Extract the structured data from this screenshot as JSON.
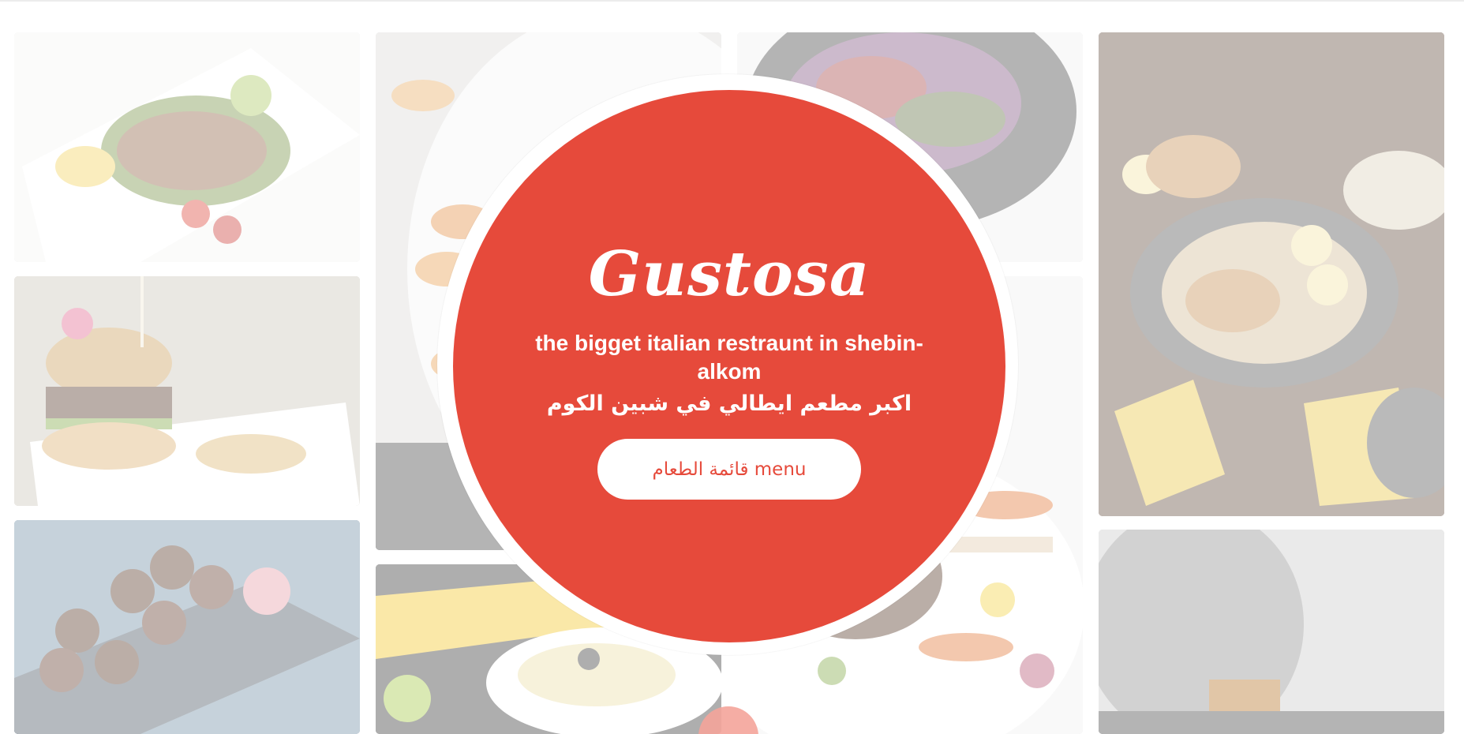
{
  "hero": {
    "title": "Gustosa",
    "tagline_en": "the bigget italian restraunt in shebin-alkom",
    "tagline_ar": "اكبر مطعم ايطالي في شبين الكوم",
    "menu_button_label": "قائمة الطعام menu"
  },
  "gallery": [
    {
      "name": "grilled-salmon-photo"
    },
    {
      "name": "burger-photo"
    },
    {
      "name": "sushi-photo"
    },
    {
      "name": "shrimp-photo"
    },
    {
      "name": "pasta-photo"
    },
    {
      "name": "salad-photo"
    },
    {
      "name": "ribs-photo"
    },
    {
      "name": "fried-platter-photo"
    },
    {
      "name": "drinks-photo"
    }
  ],
  "colors": {
    "accent": "#e64a3b",
    "button_text": "#e64a3b",
    "background": "#ffffff"
  },
  "icons": {
    "floating_dot": "scroll-indicator-dot"
  }
}
